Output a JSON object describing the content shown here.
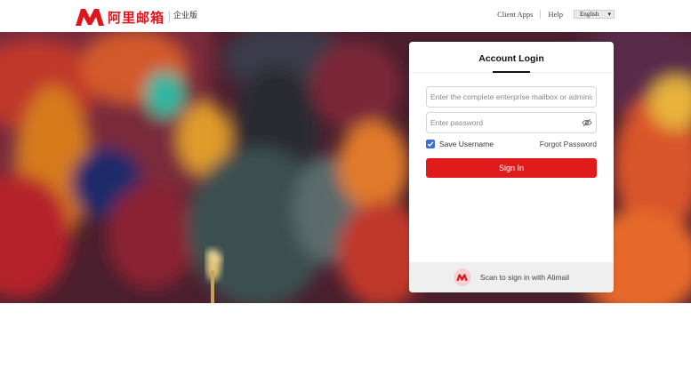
{
  "brand": {
    "name_cn": "阿里邮箱",
    "edition": "企业版",
    "color": "#e0141c"
  },
  "nav": {
    "client_apps": "Client Apps",
    "help": "Help",
    "language": "English"
  },
  "login": {
    "title": "Account Login",
    "email_placeholder": "Enter the complete enterprise mailbox or administrator account",
    "password_placeholder": "Enter password",
    "save_username": "Save Username",
    "save_username_checked": true,
    "forgot_password": "Forgot Password",
    "sign_in": "Sign In",
    "qr_text": "Scan to sign in with Alimail",
    "accent_color": "#e11b1b",
    "checkbox_color": "#3b6ed6"
  },
  "icons": {
    "logo": "alimail-m-logo",
    "password_toggle": "eye-slash-icon",
    "checkbox": "check-icon",
    "qr": "alimail-m-logo"
  }
}
